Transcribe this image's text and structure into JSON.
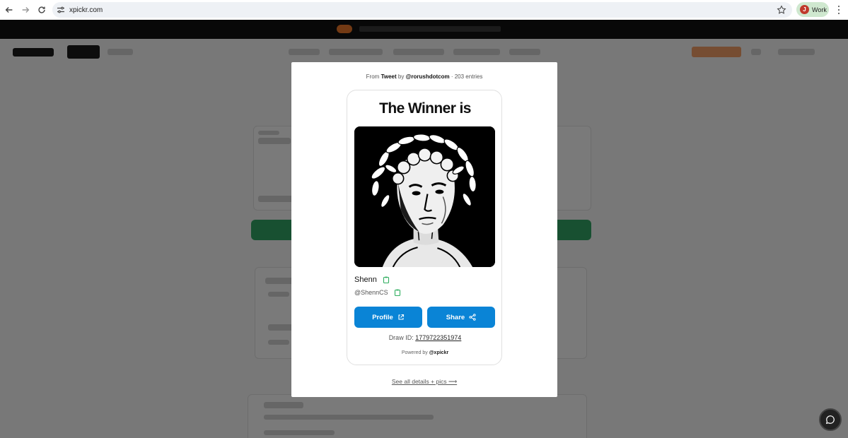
{
  "browser": {
    "url": "xpickr.com",
    "profile_initial": "J",
    "profile_name": "Work"
  },
  "modal": {
    "source_prefix": "From",
    "source_type": "Tweet",
    "source_by": "by",
    "source_handle": "@rorushdotcom",
    "source_entries": "· 203 entries",
    "title": "The Winner is",
    "winner_name": "Shenn",
    "winner_handle": "@ShennCS",
    "profile_button": "Profile",
    "share_button": "Share",
    "draw_id_label": "Draw ID:",
    "draw_id_value": "1779722351974",
    "powered_by_label": "Powered by",
    "powered_by_handle": "@xpickr",
    "see_all": "See all details + pics ⟶"
  },
  "colors": {
    "button_blue": "#0a84d6",
    "copy_icon_green": "#2fae5f",
    "avatar_red": "#c0392b",
    "profile_chip": "#cfe8cf"
  },
  "icons": {
    "back": "arrow-left-icon",
    "forward": "arrow-right-icon",
    "reload": "reload-icon",
    "site_settings": "tune-icon",
    "bookmark": "star-icon",
    "menu": "more-vert-icon",
    "copy": "clipboard-icon",
    "external": "external-link-icon",
    "share": "share-icon",
    "chat": "chat-icon"
  }
}
